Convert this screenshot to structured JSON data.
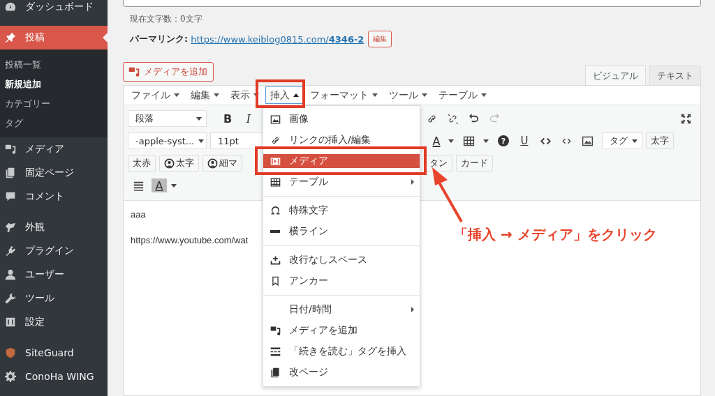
{
  "sidebar": {
    "groups": [
      [
        {
          "label": "ダッシュボード",
          "selected": false
        }
      ],
      [
        {
          "label": "投稿",
          "selected": true,
          "children": [
            {
              "label": "投稿一覧",
              "selected": false
            },
            {
              "label": "新規追加",
              "selected": true
            },
            {
              "label": "カテゴリー",
              "selected": false
            },
            {
              "label": "タグ",
              "selected": false
            }
          ]
        },
        {
          "label": "メディア",
          "selected": false
        },
        {
          "label": "固定ページ",
          "selected": false
        },
        {
          "label": "コメント",
          "selected": false
        }
      ],
      [
        {
          "label": "外観",
          "selected": false
        },
        {
          "label": "プラグイン",
          "selected": false
        },
        {
          "label": "ユーザー",
          "selected": false
        },
        {
          "label": "ツール",
          "selected": false
        },
        {
          "label": "設定",
          "selected": false
        }
      ],
      [
        {
          "label": "SiteGuard",
          "selected": false
        },
        {
          "label": "ConoHa WING",
          "selected": false
        }
      ]
    ]
  },
  "char_count": "現在文字数：0文字",
  "permalink": {
    "label": "パーマリンク:",
    "url": "https://www.keiblog0815.com/**4346-2**",
    "edit_button": "編集"
  },
  "add_media_button": "メディアを追加",
  "editor_tabs": [
    {
      "label": "ビジュアル",
      "selected": true
    },
    {
      "label": "テキスト",
      "selected": false
    }
  ],
  "menubar": [
    {
      "label": "ファイル",
      "open": false
    },
    {
      "label": "編集",
      "open": false
    },
    {
      "label": "表示",
      "open": false
    },
    {
      "label": "挿入",
      "open": true
    },
    {
      "label": "フォーマット",
      "open": false
    },
    {
      "label": "ツール",
      "open": false
    },
    {
      "label": "テーブル",
      "open": false
    }
  ],
  "toolbar": {
    "format_select": "段落",
    "bold": "B",
    "italic": "I",
    "font_select": "-apple-syst...",
    "size_select": "11pt",
    "text_color": "A",
    "help": "?",
    "underline": "U",
    "tag_select": "タグ",
    "bold_button": "太字",
    "style_buttons": [
      {
        "label": "太赤",
        "person": false
      },
      {
        "label": "太字",
        "person": true
      },
      {
        "label": "細マ",
        "person": true
      }
    ],
    "more_buttons": [
      {
        "label": "タン"
      },
      {
        "label": "カード"
      }
    ],
    "highlight": "A"
  },
  "insert_menu": [
    [
      {
        "label": "画像",
        "selected": false,
        "submenu": false
      },
      {
        "label": "リンクの挿入/編集",
        "selected": false,
        "submenu": false
      },
      {
        "label": "メディア",
        "selected": true,
        "submenu": false
      },
      {
        "label": "テーブル",
        "selected": false,
        "submenu": true
      }
    ],
    [
      {
        "label": "特殊文字",
        "selected": false,
        "submenu": false
      },
      {
        "label": "横ライン",
        "selected": false,
        "submenu": false
      }
    ],
    [
      {
        "label": "改行なしスペース",
        "selected": false,
        "submenu": false
      },
      {
        "label": "アンカー",
        "selected": false,
        "submenu": false
      }
    ],
    [
      {
        "label": "日付/時間",
        "selected": false,
        "submenu": true
      },
      {
        "label": "メディアを追加",
        "selected": false,
        "submenu": false
      },
      {
        "label": "「続きを読む」タグを挿入",
        "selected": false,
        "submenu": false
      },
      {
        "label": "改ページ",
        "selected": false,
        "submenu": false
      }
    ]
  ],
  "content": [
    "aaa",
    "https://www.youtube.com/wat"
  ],
  "annotation": "「挿入 → メディア」をクリック"
}
